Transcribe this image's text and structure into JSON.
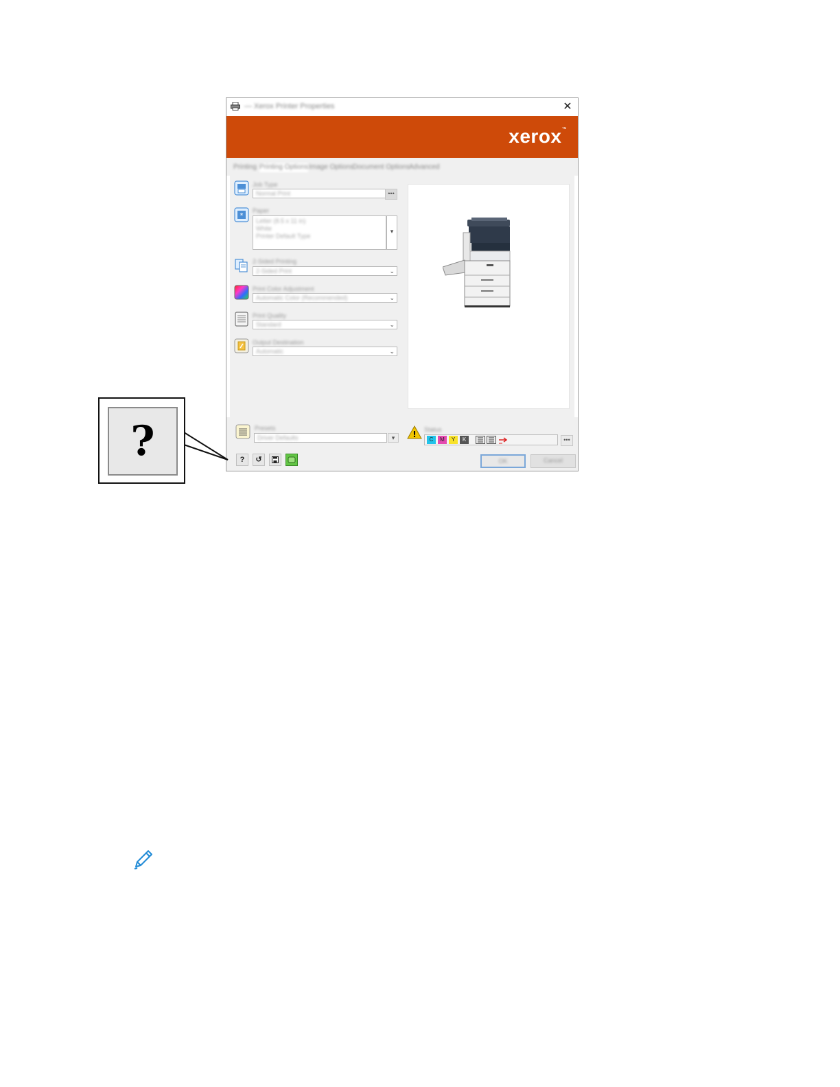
{
  "dialog": {
    "title": "— Xerox Printer Properties",
    "close_glyph": "✕",
    "logo_text": "xerox",
    "logo_tm": "™",
    "tabs": [
      "Printing",
      "Printing Options",
      "Image Options",
      "Document Options",
      "Advanced"
    ],
    "options": [
      {
        "label": "Job Type",
        "value": "Normal Print",
        "icon": "job-type-icon"
      },
      {
        "label": "Paper",
        "value_lines": [
          "Letter (8.5 x 11 in)",
          "White",
          "Printer Default Type"
        ],
        "icon": "paper-icon"
      },
      {
        "label": "2-Sided Printing",
        "value": "2-Sided Print",
        "icon": "two-sided-icon"
      },
      {
        "label": "Print Color Adjustment",
        "value": "Automatic Color (Recommended)",
        "icon": "color-icon"
      },
      {
        "label": "Print Quality",
        "value": "Standard",
        "icon": "print-quality-icon"
      },
      {
        "label": "Output Destination",
        "value": "Automatic",
        "icon": "output-destination-icon"
      }
    ],
    "ellipsis": "•••",
    "chevron": "⌄",
    "paper_dropdown_arrow": "▾",
    "preview_alt": "printer-illustration",
    "presets": {
      "label": "Presets",
      "value": "Driver Defaults"
    },
    "status": {
      "label": "Status",
      "warning_glyph": "!"
    },
    "toner_labels": [
      "C",
      "M",
      "Y",
      "K"
    ],
    "bottom_buttons": {
      "help": "?",
      "restore": "↺",
      "save": "💾"
    },
    "ok_label": "OK",
    "cancel_label": "Cancel"
  },
  "callout": {
    "glyph": "?"
  },
  "colors": {
    "brand": "#ce4a09",
    "panel": "#f0f0f0",
    "ok_border": "#7aa7d9"
  }
}
